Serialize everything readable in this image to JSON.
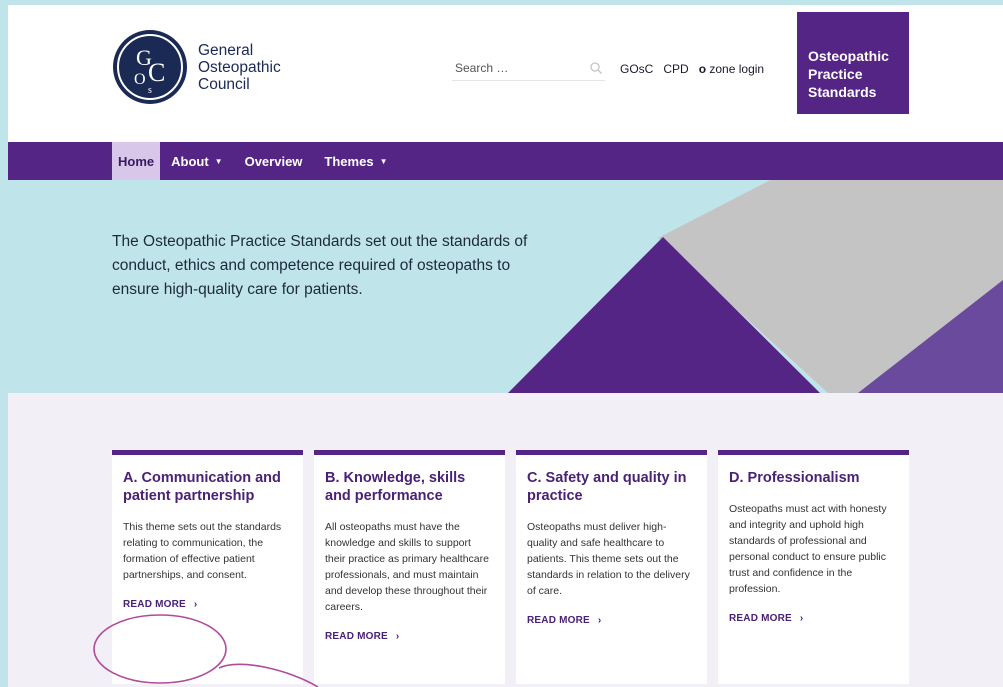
{
  "logo": {
    "lines": [
      "General",
      "Osteopathic",
      "Council"
    ]
  },
  "search": {
    "placeholder": "Search …"
  },
  "toplinks": {
    "gosc": "GOsC",
    "cpd": "CPD",
    "o": "o",
    "zone": "zone login"
  },
  "ops_box": {
    "lines": [
      "Osteopathic",
      "Practice",
      "Standards"
    ]
  },
  "nav": {
    "items": [
      {
        "label": "Home",
        "active": true
      },
      {
        "label": "About",
        "caret": "▼"
      },
      {
        "label": "Overview"
      },
      {
        "label": "Themes",
        "caret": "▼"
      }
    ]
  },
  "hero": {
    "text": "The Osteopathic Practice Standards set out the standards of conduct, ethics and competence required of osteopaths to ensure high-quality care for patients."
  },
  "cards": [
    {
      "title": "A. Communication and patient partnership",
      "body": "This theme sets out the standards relating to communication, the formation of effective patient partnerships, and consent.",
      "link": "READ MORE",
      "chev": "›"
    },
    {
      "title": "B. Knowledge, skills and performance",
      "body": "All osteopaths must have the knowledge and skills to support their practice as primary healthcare professionals, and must maintain and develop these throughout their careers.",
      "link": "READ MORE",
      "chev": "›"
    },
    {
      "title": "C. Safety and quality in practice",
      "body": "Osteopaths must deliver high-quality and safe healthcare to patients. This theme sets out the standards in relation to the delivery of care.",
      "link": "READ MORE",
      "chev": "›"
    },
    {
      "title": "D. Professionalism",
      "body": "Osteopaths must act with honesty and integrity and uphold high standards of professional and personal conduct to ensure public trust and confidence in the profession.",
      "link": "READ MORE",
      "chev": "›"
    }
  ],
  "colors": {
    "brand_purple": "#552585",
    "hero_bg": "#bfe4e9",
    "annotation": "#b04a9a"
  }
}
